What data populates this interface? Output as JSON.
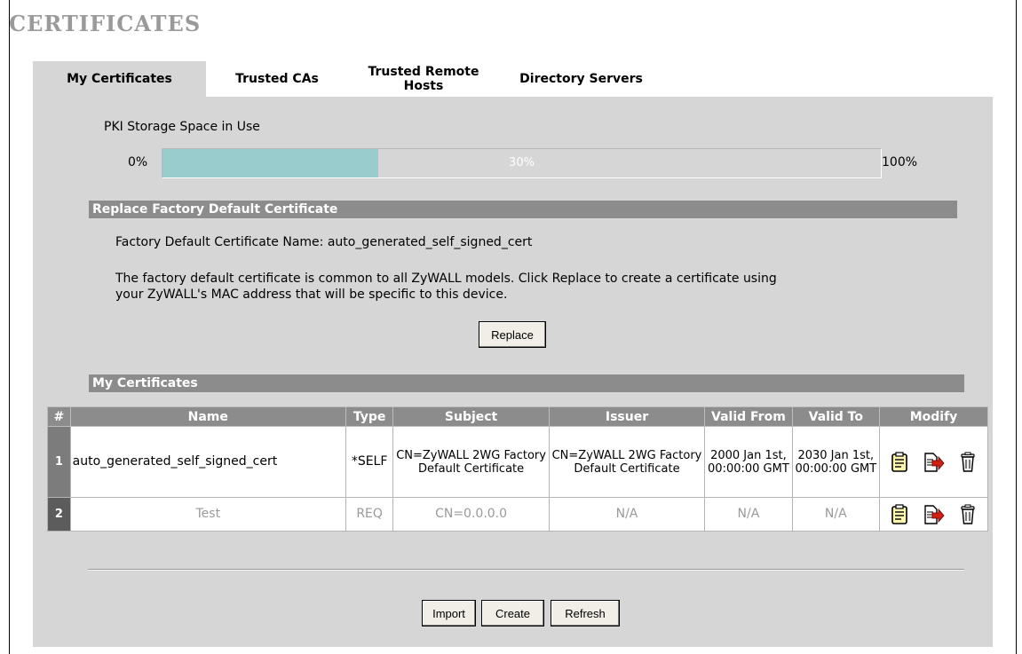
{
  "page": {
    "title": "CERTIFICATES"
  },
  "tabs": [
    {
      "label": "My Certificates",
      "active": true
    },
    {
      "label": "Trusted CAs",
      "active": false
    },
    {
      "label": "Trusted Remote Hosts",
      "active": false
    },
    {
      "label": "Directory Servers",
      "active": false
    }
  ],
  "storage": {
    "label": "PKI Storage Space in Use",
    "min_label": "0%",
    "max_label": "100%",
    "percent_label": "30%",
    "used_fraction": 0.3,
    "fill_color": "#99cccc"
  },
  "replace_section": {
    "heading": "Replace Factory Default Certificate",
    "name_line": "Factory Default Certificate Name: auto_generated_self_signed_cert",
    "info_line1": "The factory default certificate is common to all ZyWALL models. Click Replace to create a certificate using",
    "info_line2": "your ZyWALL's MAC address that will be specific to this device.",
    "replace_button": "Replace"
  },
  "certificates": {
    "heading": "My Certificates",
    "columns": [
      "#",
      "Name",
      "Type",
      "Subject",
      "Issuer",
      "Valid From",
      "Valid To",
      "Modify"
    ],
    "rows": [
      {
        "num": "1",
        "name": "auto_generated_self_signed_cert",
        "type": "*SELF",
        "subject": "CN=ZyWALL 2WG Factory Default Certificate",
        "issuer": "CN=ZyWALL 2WG Factory Default Certificate",
        "valid_from": "2000 Jan 1st, 00:00:00 GMT",
        "valid_to": "2030 Jan 1st, 00:00:00 GMT"
      },
      {
        "num": "2",
        "name": "Test",
        "type": "REQ",
        "subject": "CN=0.0.0.0",
        "issuer": "N/A",
        "valid_from": "N/A",
        "valid_to": "N/A"
      }
    ],
    "modify_icons": [
      "details-icon",
      "export-icon",
      "delete-icon"
    ]
  },
  "footer_buttons": {
    "import": "Import",
    "create": "Create",
    "refresh": "Refresh"
  },
  "colors": {
    "panel": "#d6d6d6",
    "header": "#8c8c8c",
    "title": "#9a9a9a"
  }
}
